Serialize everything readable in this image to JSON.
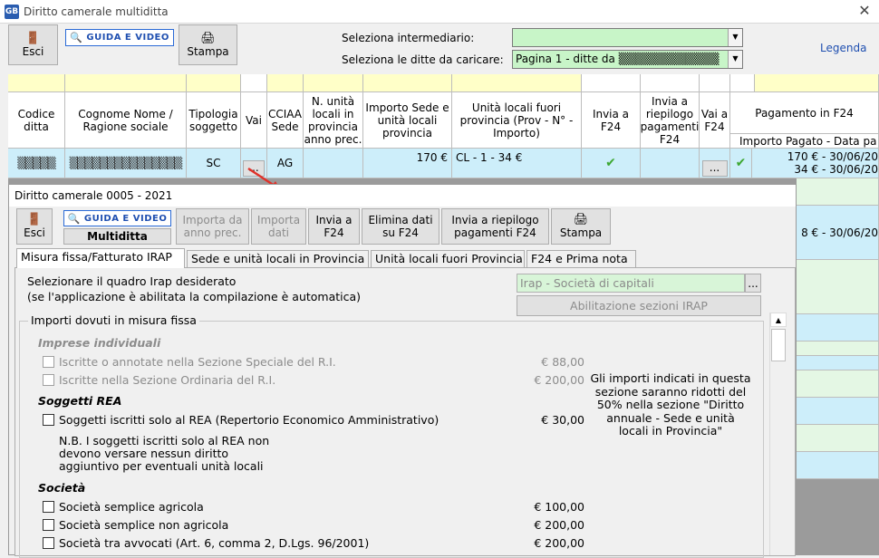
{
  "window": {
    "title": "Diritto camerale multiditta",
    "logo": "GB",
    "close": "✕"
  },
  "toolbar": {
    "esci": "Esci",
    "guida": "GUIDA E VIDEO",
    "stampa": "Stampa"
  },
  "filters": {
    "intermediario_label": "Seleziona intermediario:",
    "intermediario_value": "",
    "ditte_label": "Seleziona le ditte da caricare:",
    "ditte_value": "Pagina 1 - ditte da ▒▒▒▒▒▒▒▒▒▒▒▒"
  },
  "legenda": "Legenda",
  "grid": {
    "headers": [
      "Codice ditta",
      "Cognome Nome / Ragione sociale",
      "Tipologia soggetto",
      "Vai",
      "CCIAA Sede",
      "N. unità locali in provincia anno prec.",
      "Importo Sede e unità locali provincia",
      "Unità locali fuori provincia (Prov - N° - Importo)",
      "Invia a F24",
      "Invia a riepilogo pagamenti F24",
      "Vai a F24",
      "Pagamento in F24"
    ],
    "subheader": "Importo Pagato - Data pa",
    "row1": {
      "codice": "▒▒▒▒▒",
      "nome": "▒▒▒▒▒▒▒▒▒▒▒▒▒▒▒",
      "tipologia": "SC",
      "vai": "...",
      "cciaa": "AG",
      "importo": "170 €",
      "fuori": "CL - 1 - 34 €",
      "vai_f24": "...",
      "pagamento1": "170 € - 30/06/20",
      "pagamento2": "34 € - 30/06/20"
    },
    "row_partial": "8 € - 30/06/20"
  },
  "dialog": {
    "title": "Diritto camerale 0005 - 2021",
    "buttons": {
      "esci": "Esci",
      "guida": "GUIDA E VIDEO",
      "multiditta": "Multiditta",
      "importa_anno": "Importa da anno prec.",
      "importa_dati": "Importa dati",
      "invia_f24": "Invia a F24",
      "elimina": "Elimina dati su F24",
      "invia_riepilogo": "Invia a riepilogo pagamenti F24",
      "stampa": "Stampa"
    },
    "tabs": [
      "Misura fissa/Fatturato IRAP",
      "Sede e unità locali in Provincia",
      "Unità locali fuori Provincia",
      "F24 e Prima nota"
    ],
    "irap_label1": "Selezionare il quadro Irap desiderato",
    "irap_label2": "(se l'applicazione è abilitata la compilazione è automatica)",
    "irap_value": "Irap - Società di capitali",
    "irap_btn": "...",
    "abilitazione": "Abilitazione sezioni IRAP",
    "group_title": "Importi dovuti in misura fissa",
    "imprese_title": "Imprese individuali",
    "imprese": [
      {
        "label": "Iscritte o annotate nella Sezione Speciale del R.I.",
        "amount": "€ 88,00"
      },
      {
        "label": "Iscritte nella Sezione Ordinaria del R.I.",
        "amount": "€ 200,00"
      }
    ],
    "rea_title": "Soggetti REA",
    "rea": {
      "label": "Soggetti iscritti solo al REA (Repertorio Economico Amministrativo)",
      "amount": "€ 30,00"
    },
    "nb1": "N.B. I soggetti iscritti solo al REA non",
    "nb2": "devono versare nessun diritto",
    "nb3": "aggiuntivo per eventuali unità locali",
    "note1": "Gli importi indicati in questa",
    "note2": "sezione saranno ridotti del",
    "note3": "50% nella sezione \"Diritto",
    "note4": "annuale - Sede e unità",
    "note5": "locali in Provincia\"",
    "societa_title": "Società",
    "societa": [
      {
        "label": "Società semplice agricola",
        "amount": "€ 100,00"
      },
      {
        "label": "Società semplice non agricola",
        "amount": "€ 200,00"
      },
      {
        "label": "Società tra avvocati (Art. 6, comma 2, D.Lgs. 96/2001)",
        "amount": "€ 200,00"
      }
    ]
  }
}
